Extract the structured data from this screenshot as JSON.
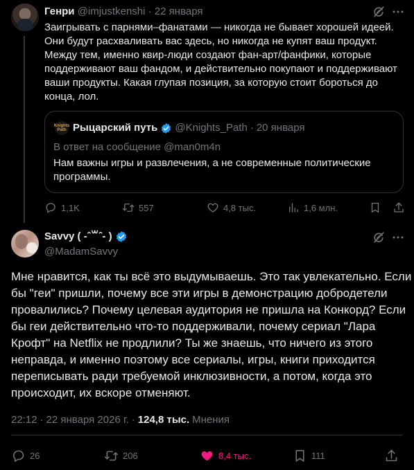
{
  "parent": {
    "name": "Генри",
    "handle": "@imjustkenshi",
    "sep": "·",
    "date": "22 января",
    "text_lines": [
      "Заигрывать с парнями–фанатами — никогда не бывает хорошей идеей.",
      "Они будут расхваливать вас здесь, но никогда не купят ваш продукт.",
      "Между тем, именно квир-люди создают фан-арт/фанфики, которые",
      "поддерживают ваш фандом, и действительно покупают и поддерживают",
      "ваши продукты. Какая глупая позиция, за которую стоит бороться до",
      "конца, лол."
    ],
    "quote": {
      "avatar_text": "Knights Path",
      "name": "Рыцарский путь",
      "handle": "@Knights_Path",
      "sep": "·",
      "date": "20 января",
      "reply_to": "В ответ на сообщение @man0m4n",
      "text_lines": [
        "Нам важны игры и развлечения, а не современные политические",
        "программы."
      ]
    },
    "actions": {
      "replies": "1,1K",
      "reposts": "557",
      "likes": "4,8 тыс.",
      "views": "1,6 млн."
    }
  },
  "main": {
    "name": "Savvy ( -ˆ꒳ˆ- )",
    "handle": "@MadamSavvy",
    "text_lines": [
      "Мне нравится, как ты всё это выдумываешь. Это так увлекательно. Если",
      "бы \"геи\" пришли, почему все эти игры в демонстрацию добродетели",
      "провалились? Почему целевая аудитория не пришла на Конкорд? Если",
      "бы геи действительно что-то поддерживали, почему сериал \"Лара",
      "Крофт\" на Netflix не продлили? Ты же знаешь, что ничего из этого",
      "неправда, и именно поэтому все сериалы, игры, книги приходится",
      "переписывать ради требуемой инклюзивности, а потом, когда это",
      "происходит, их вскоре отменяют."
    ],
    "time": "22:12",
    "sep1": "·",
    "date": "22 января 2026 г.",
    "sep2": "·",
    "views_count": "124,8 тыс.",
    "views_label": "Мнения",
    "actions": {
      "replies": "26",
      "reposts": "206",
      "likes": "8,4 тыс.",
      "bookmarks": "111"
    }
  },
  "colors": {
    "background": "#000000",
    "text": "#e7e9ea",
    "muted": "#71767b",
    "verified": "#1d9bf0",
    "like_active": "#f91880",
    "border": "#2f3336"
  },
  "icons": [
    "grok-icon",
    "more-icon",
    "verified-badge-icon",
    "reply-icon",
    "repost-icon",
    "like-icon",
    "views-icon",
    "bookmark-icon",
    "share-icon"
  ]
}
